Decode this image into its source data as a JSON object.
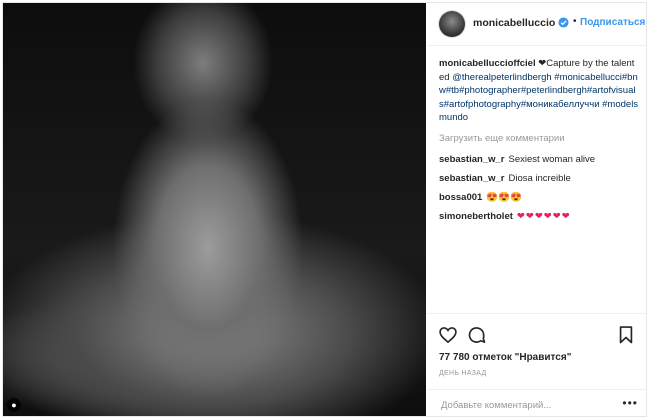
{
  "header": {
    "username": "monicabelluccioff...",
    "follow_label": "Подписаться",
    "separator": "•"
  },
  "caption": {
    "author": "monicabelluccioffciel",
    "heart": "❤",
    "text_before_mention": "Capture by the talented ",
    "mention": "@therealpeterlindbergh",
    "hashtags": "#monicabellucci#bnw#tb#photographer#peterlindbergh#artofvisuals#artofphotography#моникабеллуччи #modelsmundo"
  },
  "load_more": "Загрузить еще комментарии",
  "comments": [
    {
      "user": "sebastian_w_r",
      "text": "Sexiest woman alive"
    },
    {
      "user": "sebastian_w_r",
      "text": "Diosa increible"
    },
    {
      "user": "bossa001",
      "text": "😍😍😍"
    },
    {
      "user": "simonebertholet",
      "text": "❤❤❤❤❤❤"
    }
  ],
  "likes": "77 780 отметок \"Нравится\"",
  "time": "ДЕНЬ НАЗАД",
  "comment_box": {
    "placeholder": "Добавьте комментарий...",
    "more": "•••"
  },
  "icons": {
    "like": "heart-outline-icon",
    "comment": "speech-bubble-icon",
    "save": "bookmark-icon",
    "verified": "verified-badge-icon"
  },
  "colors": {
    "link_blue": "#3897f0",
    "hashtag": "#003569",
    "muted": "#999999",
    "heart_red": "#e0245e"
  }
}
